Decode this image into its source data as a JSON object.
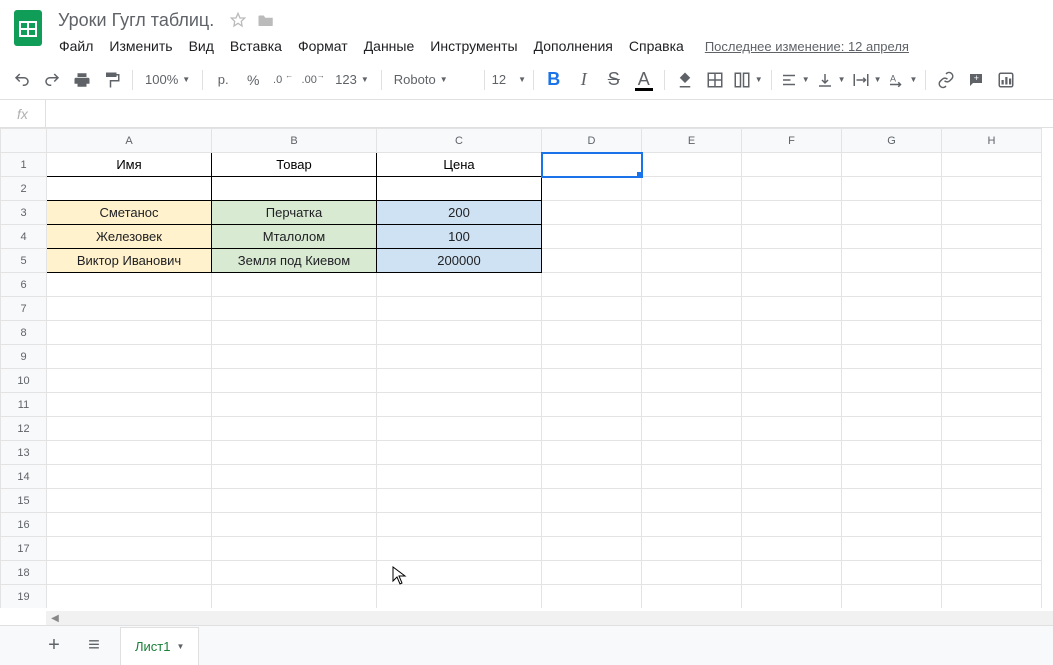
{
  "doc": {
    "title": "Уроки Гугл таблиц."
  },
  "menu": {
    "file": "Файл",
    "edit": "Изменить",
    "view": "Вид",
    "insert": "Вставка",
    "format": "Формат",
    "data": "Данные",
    "tools": "Инструменты",
    "addons": "Дополнения",
    "help": "Справка",
    "last_edit": "Последнее изменение: 12 апреля"
  },
  "toolbar": {
    "zoom": "100%",
    "currency": "р.",
    "percent": "%",
    "dec_less": ".0",
    "dec_more": ".00",
    "num_fmt": "123",
    "font": "Roboto",
    "size": "12"
  },
  "formula": {
    "fx": "fx",
    "value": ""
  },
  "columns": [
    "A",
    "B",
    "C",
    "D",
    "E",
    "F",
    "G",
    "H"
  ],
  "row_count": 21,
  "headers": {
    "a": "Имя",
    "b": "Товар",
    "c": "Цена"
  },
  "rows": [
    {
      "a": "Сметанос",
      "b": "Перчатка",
      "c": "200"
    },
    {
      "a": "Железовек",
      "b": "Мталолом",
      "c": "100"
    },
    {
      "a": "Виктор Иванович",
      "b": "Земля под Киевом",
      "c": "200000"
    }
  ],
  "active_cell": "D1",
  "sheet": {
    "name": "Лист1"
  }
}
